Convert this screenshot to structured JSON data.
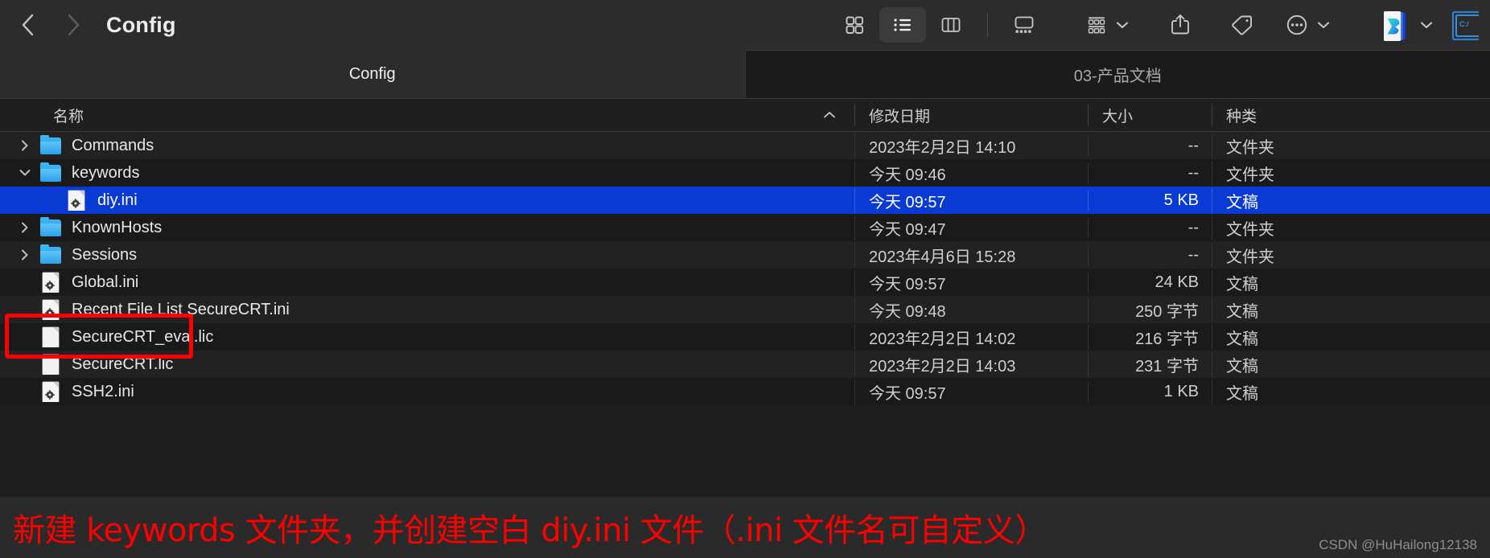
{
  "window": {
    "title": "Config",
    "accent_selection": "#0a3ad4",
    "annotation_color": "#ff0000",
    "folder_icon_color": "#2ea0ea"
  },
  "toolbar": {
    "back_icon": "chevron-left-icon",
    "forward_icon": "chevron-right-icon",
    "view_buttons": [
      {
        "name": "icon-view",
        "label": "as-icons",
        "icon": "grid-icon",
        "active": false
      },
      {
        "name": "list-view",
        "label": "as-list",
        "icon": "list-icon",
        "active": true
      },
      {
        "name": "column-view",
        "label": "as-columns",
        "icon": "columns-icon",
        "active": false
      },
      {
        "name": "gallery-view",
        "label": "as-gallery",
        "icon": "gallery-icon",
        "active": false
      }
    ],
    "group_by": {
      "name": "group-by-button",
      "icon": "group-icon"
    },
    "share": {
      "name": "share-button",
      "icon": "share-icon"
    },
    "tag": {
      "name": "tag-button",
      "icon": "tag-icon"
    },
    "more": {
      "name": "more-button",
      "icon": "ellipsis-circle-icon"
    },
    "app_badge": {
      "name": "synology-drive-icon",
      "icon": "app-d-icon"
    },
    "edge_app": {
      "name": "terminal-app-icon",
      "icon": "terminal-icon",
      "label": "C:/"
    }
  },
  "tabs": [
    {
      "label": "Config",
      "active": true
    },
    {
      "label": "03-产品文档",
      "active": false
    }
  ],
  "columns": [
    {
      "key": "name",
      "label": "名称",
      "sorted": true,
      "sort_direction": "ascending"
    },
    {
      "key": "date",
      "label": "修改日期",
      "sorted": false
    },
    {
      "key": "size",
      "label": "大小",
      "sorted": false
    },
    {
      "key": "kind",
      "label": "种类",
      "sorted": false
    }
  ],
  "rows": [
    {
      "name": "Commands",
      "date": "2023年2月2日 14:10",
      "size": "--",
      "kind": "文件夹",
      "icon": "folder-icon",
      "indent": 0,
      "disclosure": "collapsed",
      "selected": false
    },
    {
      "name": "keywords",
      "date": "今天 09:46",
      "size": "--",
      "kind": "文件夹",
      "icon": "folder-icon",
      "indent": 0,
      "disclosure": "expanded",
      "selected": false
    },
    {
      "name": "diy.ini",
      "date": "今天 09:57",
      "size": "5 KB",
      "kind": "文稿",
      "icon": "gear-document-icon",
      "indent": 1,
      "disclosure": "none",
      "selected": true
    },
    {
      "name": "KnownHosts",
      "date": "今天 09:47",
      "size": "--",
      "kind": "文件夹",
      "icon": "folder-icon",
      "indent": 0,
      "disclosure": "collapsed",
      "selected": false
    },
    {
      "name": "Sessions",
      "date": "2023年4月6日 15:28",
      "size": "--",
      "kind": "文件夹",
      "icon": "folder-icon",
      "indent": 0,
      "disclosure": "collapsed",
      "selected": false
    },
    {
      "name": "Global.ini",
      "date": "今天 09:57",
      "size": "24 KB",
      "kind": "文稿",
      "icon": "gear-document-icon",
      "indent": 0,
      "disclosure": "none",
      "selected": false
    },
    {
      "name": "Recent File List SecureCRT.ini",
      "date": "今天 09:48",
      "size": "250 字节",
      "kind": "文稿",
      "icon": "gear-document-icon",
      "indent": 0,
      "disclosure": "none",
      "selected": false
    },
    {
      "name": "SecureCRT_eval.lic",
      "date": "2023年2月2日 14:02",
      "size": "216 字节",
      "kind": "文稿",
      "icon": "document-icon",
      "indent": 0,
      "disclosure": "none",
      "selected": false
    },
    {
      "name": "SecureCRT.lic",
      "date": "2023年2月2日 14:03",
      "size": "231 字节",
      "kind": "文稿",
      "icon": "document-icon",
      "indent": 0,
      "disclosure": "none",
      "selected": false
    },
    {
      "name": "SSH2.ini",
      "date": "今天 09:57",
      "size": "1 KB",
      "kind": "文稿",
      "icon": "gear-document-icon",
      "indent": 0,
      "disclosure": "none",
      "selected": false
    }
  ],
  "annotation": {
    "text": "新建 keywords 文件夹，并创建空白 diy.ini 文件（.ini 文件名可自定义）",
    "highlight_target": "keywords folder and diy.ini row"
  },
  "watermark": {
    "text": "CSDN @HuHailong12138"
  }
}
